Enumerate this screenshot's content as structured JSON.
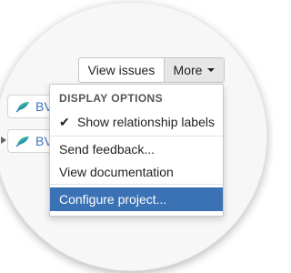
{
  "toolbar": {
    "view_issues_label": "View issues",
    "more_label": "More"
  },
  "diagram": {
    "nodes": [
      {
        "label": "BV",
        "icon": "leaf-icon"
      },
      {
        "label": "BV",
        "icon": "leaf-icon"
      }
    ]
  },
  "menu": {
    "header": "DISPLAY OPTIONS",
    "show_labels": {
      "label": "Show relationship labels",
      "checked": true,
      "check_glyph": "✔"
    },
    "send_feedback": "Send feedback...",
    "view_documentation": "View documentation",
    "configure_project": "Configure project..."
  },
  "colors": {
    "accent": "#3a72b5",
    "node_text": "#3d74b7"
  }
}
